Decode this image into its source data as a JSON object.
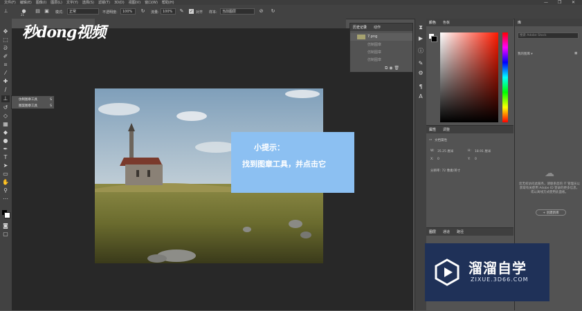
{
  "menu": [
    "文件(F)",
    "编辑(E)",
    "图像(I)",
    "图层(L)",
    "文字(Y)",
    "选择(S)",
    "滤镜(T)",
    "3D(D)",
    "视图(V)",
    "窗口(W)",
    "帮助(H)"
  ],
  "window_controls": {
    "minimize": "—",
    "restore": "❐",
    "close": "✕"
  },
  "options": {
    "brush_size": "21",
    "mode_label": "模式:",
    "mode_value": "正常",
    "opacity_label": "不透明度:",
    "opacity_value": "100%",
    "flow_label": "流量:",
    "flow_value": "100%",
    "aligned_label": "对齐",
    "sample_label": "样本:",
    "sample_value": "当前图层"
  },
  "logo_text": "秒dong视频",
  "tool_flyout": {
    "items": [
      {
        "label": "仿制图章工具",
        "key": "S"
      },
      {
        "label": "图案图章工具",
        "key": "S"
      }
    ]
  },
  "tip": {
    "title": "小提示：",
    "body": "找到图章工具，并点击它"
  },
  "history": {
    "tabs": [
      "历史记录",
      "动作"
    ],
    "snapshot": "7.png",
    "rows": [
      "仿制图章",
      "仿制图章",
      "仿制图章",
      "仿制图章"
    ]
  },
  "color": {
    "tabs": [
      "颜色",
      "色板"
    ]
  },
  "properties": {
    "tabs": [
      "属性",
      "调整"
    ],
    "title": "文档属性",
    "w_label": "W:",
    "w_value": "35.25 厘米",
    "h_label": "H:",
    "h_value": "18.91 厘米",
    "x_label": "X:",
    "x_value": "0",
    "y_label": "Y:",
    "y_value": "0",
    "resolution": "分辨率: 72 像素/英寸"
  },
  "layers": {
    "tabs": [
      "图层",
      "通道",
      "路径"
    ]
  },
  "library": {
    "title": "库",
    "search_placeholder": "搜索 Adobe Stock",
    "dropdown": "我的图库 ▾",
    "offline_msg": "您无权访问此服务，请联系您的 IT 管理员以获取有关使用 Adobe ID 登录的更多信息，或以离线方式使用此面板。",
    "create_button": "+ 创建新库"
  },
  "watermark": {
    "big": "溜溜自学",
    "small": "ZIXUE.3D66.COM"
  },
  "colors": {
    "tip_bg": "#8cc0f2",
    "watermark_bg": "#1f3158",
    "panel": "#535353"
  }
}
